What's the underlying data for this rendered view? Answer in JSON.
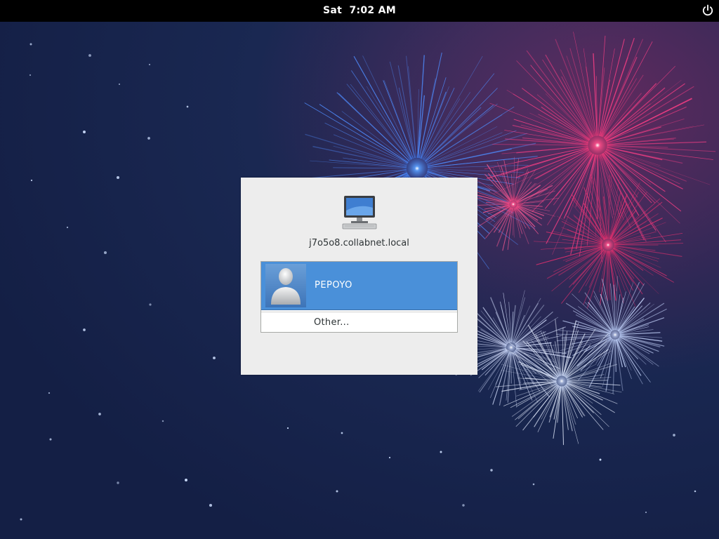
{
  "topbar": {
    "day": "Sat",
    "time": "7:02 AM"
  },
  "icons": {
    "power": "power-icon",
    "computer": "computer-icon",
    "avatar": "avatar-icon"
  },
  "dialog": {
    "hostname": "j7o5o8.collabnet.local",
    "users": [
      {
        "name": "PEPOYO",
        "selected": true
      }
    ],
    "other_label": "Other..."
  },
  "colors": {
    "topbar_bg": "#000000",
    "selection": "#4a90d9",
    "dialog_bg": "#ededed",
    "wallpaper_base": "#1b2a55"
  }
}
